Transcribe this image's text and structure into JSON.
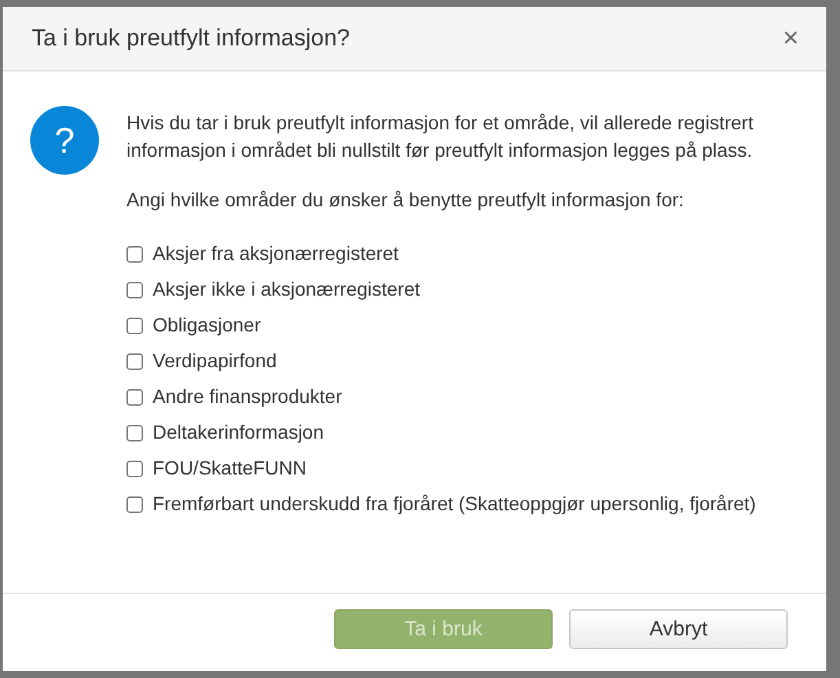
{
  "dialog": {
    "title": "Ta i bruk preutfylt informasjon?",
    "close": "×",
    "icon": "?",
    "message": "Hvis du tar i bruk preutfylt informasjon for et område, vil allerede registrert informasjon i området bli nullstilt før preutfylt informasjon legges på plass.",
    "prompt": "Angi hvilke områder du ønsker å benytte preutfylt informasjon for:",
    "options": [
      {
        "label": "Aksjer fra aksjonærregisteret",
        "checked": false
      },
      {
        "label": "Aksjer ikke i aksjonærregisteret",
        "checked": false
      },
      {
        "label": "Obligasjoner",
        "checked": false
      },
      {
        "label": "Verdipapirfond",
        "checked": false
      },
      {
        "label": "Andre finansprodukter",
        "checked": false
      },
      {
        "label": "Deltakerinformasjon",
        "checked": false
      },
      {
        "label": "FOU/SkatteFUNN",
        "checked": false
      },
      {
        "label": "Fremførbart underskudd fra fjoråret (Skatteoppgjør upersonlig, fjoråret)",
        "checked": false
      }
    ],
    "buttons": [
      {
        "label": "Ta i bruk",
        "kind": "primary",
        "disabled": true
      },
      {
        "label": "Avbryt",
        "kind": "secondary",
        "disabled": false
      }
    ]
  }
}
